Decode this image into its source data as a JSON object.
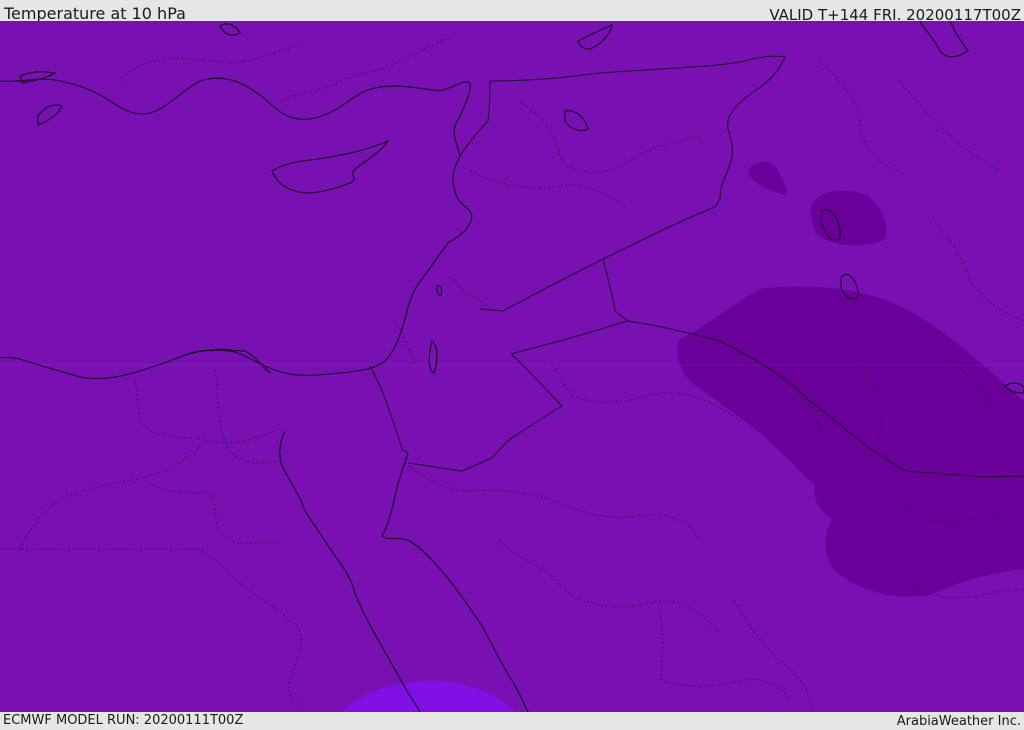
{
  "header": {
    "title": "Temperature at 10 hPa",
    "valid": "VALID T+144 FRI. 20200117T00Z"
  },
  "footer": {
    "model_run": "ECMWF MODEL RUN: 20200111T00Z",
    "credit": "ArabiaWeather Inc."
  },
  "map": {
    "parameter": "Temperature",
    "level": "10 hPa",
    "colors": {
      "field_base": "#7911b2",
      "field_cold": "#6a0099",
      "field_warm": "#8110e6",
      "coastline": "#150a20",
      "border": "#1a1025"
    }
  }
}
